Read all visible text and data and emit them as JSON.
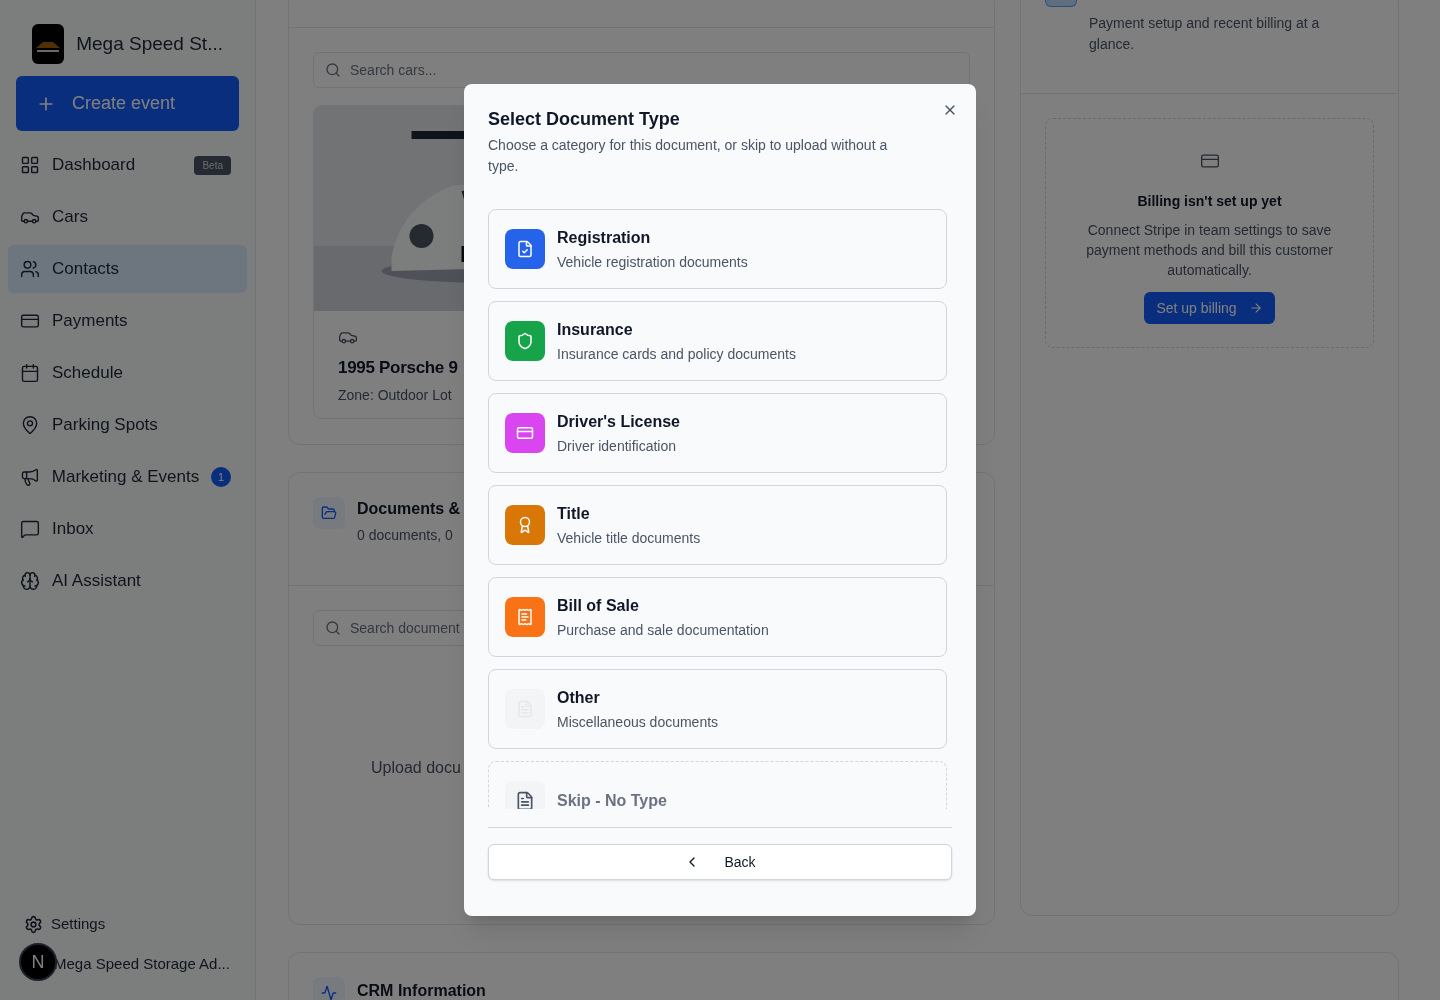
{
  "sidebar": {
    "brand": "Mega Speed St...",
    "create_button": "Create event",
    "items": [
      {
        "label": "Dashboard",
        "badge": {
          "text": "Beta",
          "kind": "tag"
        },
        "selected": false
      },
      {
        "label": "Cars",
        "selected": false
      },
      {
        "label": "Contacts",
        "selected": true
      },
      {
        "label": "Payments",
        "selected": false
      },
      {
        "label": "Schedule",
        "selected": false
      },
      {
        "label": "Parking Spots",
        "selected": false
      },
      {
        "label": "Marketing & Events",
        "badge": {
          "text": "1",
          "kind": "count"
        },
        "selected": false
      },
      {
        "label": "Inbox",
        "selected": false
      },
      {
        "label": "AI Assistant",
        "selected": false
      }
    ],
    "settings": "Settings",
    "user": "Mega Speed Storage Ad...",
    "avatar": "N"
  },
  "cars_card": {
    "search": {
      "placeholder": "Search cars..."
    },
    "car": {
      "title": "1995 Porsche 9",
      "zone": "Zone: Outdoor Lot"
    }
  },
  "documents_card": {
    "title": "Documents &",
    "subtitle": "0 documents, 0",
    "search": {
      "placeholder": "Search document"
    },
    "upload": "Upload docu"
  },
  "billing_card": {
    "description": "Payment setup and recent billing at a glance.",
    "empty_title": "Billing isn't set up yet",
    "empty_text": "Connect Stripe in team settings to save payment methods and bill this customer automatically.",
    "button": "Set up billing"
  },
  "crm_card": {
    "title": "CRM Information"
  },
  "dialog": {
    "title": "Select Document Type",
    "description": "Choose a category for this document, or skip to upload without a type.",
    "options": [
      {
        "kind": "type",
        "color": "#2563eb",
        "title": "Registration",
        "subtitle": "Vehicle registration documents"
      },
      {
        "kind": "type",
        "color": "#16a34a",
        "title": "Insurance",
        "subtitle": "Insurance cards and policy documents"
      },
      {
        "kind": "type",
        "color": "#d946ef",
        "title": "Driver's License",
        "subtitle": "Driver identification"
      },
      {
        "kind": "type",
        "color": "#d97706",
        "title": "Title",
        "subtitle": "Vehicle title documents"
      },
      {
        "kind": "type",
        "color": "#f97316",
        "title": "Bill of Sale",
        "subtitle": "Purchase and sale documentation"
      },
      {
        "kind": "type",
        "color": "#f3f4f6",
        "title": "Other",
        "subtitle": "Miscellaneous documents"
      },
      {
        "kind": "skip",
        "title": "Skip - No Type"
      }
    ],
    "back_button": "Back"
  }
}
